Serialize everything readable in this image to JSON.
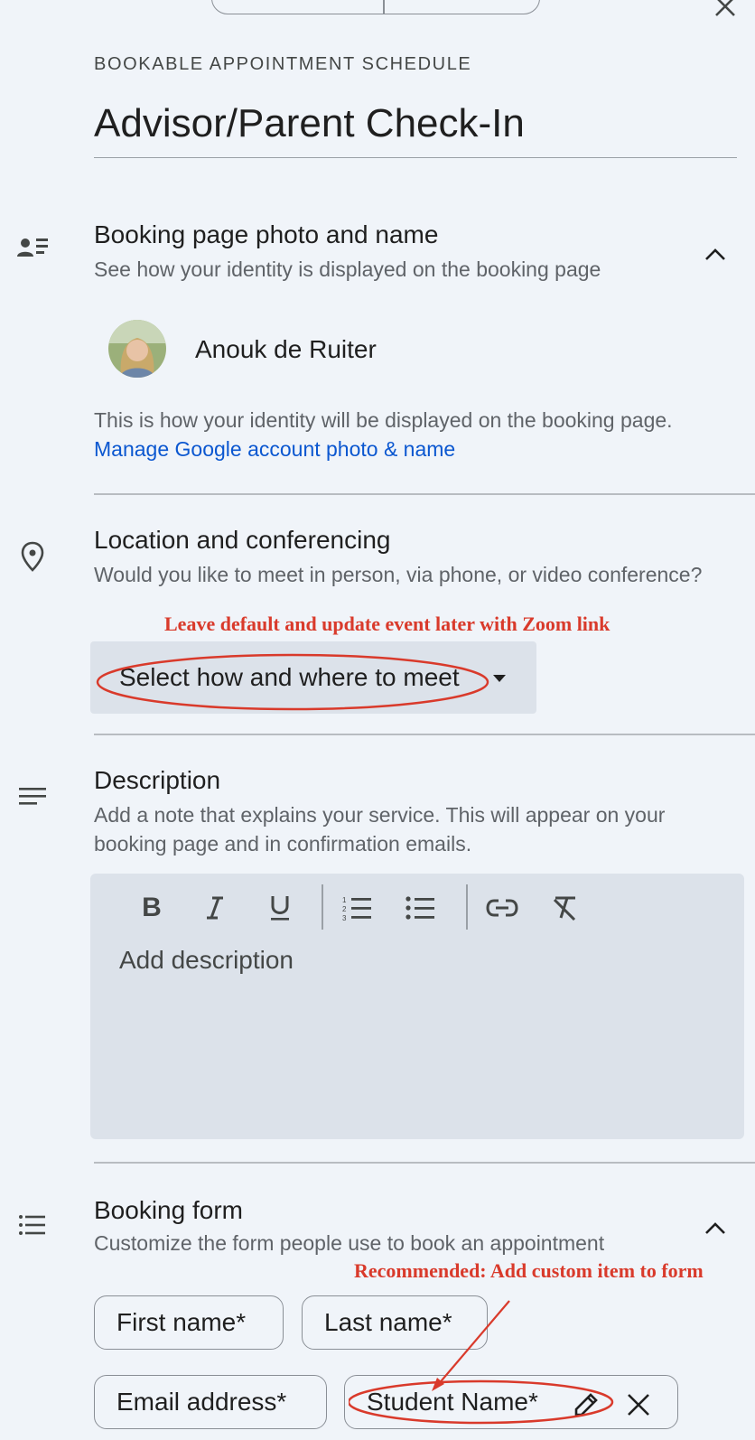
{
  "header": {
    "eyebrow": "BOOKABLE APPOINTMENT SCHEDULE",
    "title_value": "Advisor/Parent Check-In"
  },
  "booking_page": {
    "title": "Booking page photo and name",
    "subtitle": "See how your identity is displayed on the booking page",
    "profile_name": "Anouk de Ruiter",
    "identity_text": "This is how your identity will be displayed on the booking page.",
    "manage_link": "Manage Google account photo & name"
  },
  "location": {
    "title": "Location and conferencing",
    "subtitle": "Would you like to meet in person, via phone, or video conference?",
    "annotation": "Leave default and update event later with Zoom link",
    "select_label": "Select how and where to meet"
  },
  "description": {
    "title": "Description",
    "subtitle": "Add a note that explains your service. This will appear on your booking page and in confirmation emails.",
    "placeholder": "Add description",
    "toolbar": [
      "bold",
      "italic",
      "underline",
      "numbered-list",
      "bulleted-list",
      "link",
      "clear-formatting"
    ]
  },
  "booking_form": {
    "title": "Booking form",
    "subtitle": "Customize the form people use to book an appointment",
    "annotation": "Recommended: Add custom item to form",
    "fields": [
      "First name*",
      "Last name*",
      "Email address*",
      "Student Name*"
    ]
  },
  "colors": {
    "background": "#f0f4f9",
    "field_fill": "#dce2ea",
    "link": "#0b57d0",
    "annotation": "#d93a2b"
  }
}
